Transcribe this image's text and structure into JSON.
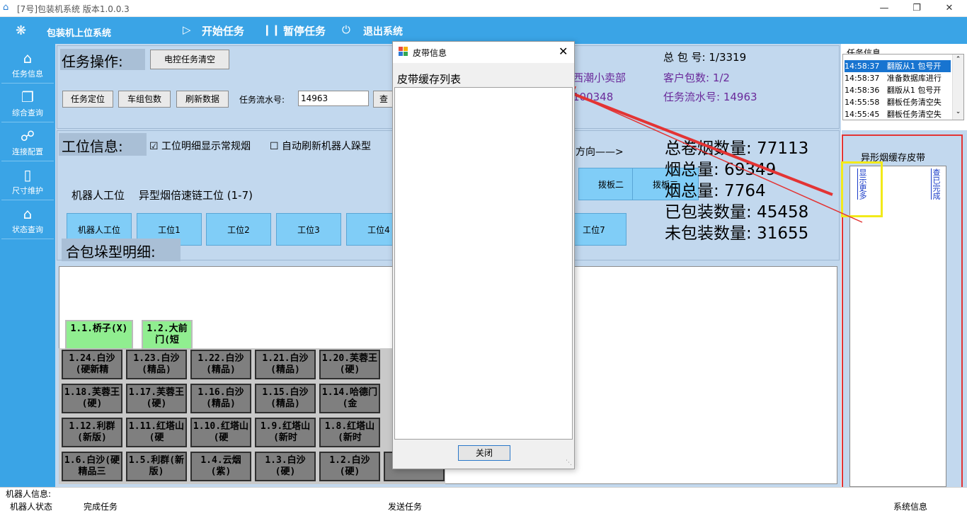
{
  "window": {
    "title": "[7号]包装机系统 版本1.0.0.3"
  },
  "topbar": {
    "system_name": "包装机上位系统",
    "start_task": "开始任务",
    "pause_task": "暂停任务",
    "exit_system": "退出系统"
  },
  "nav": [
    {
      "label": "任务信息",
      "icon": "home-icon"
    },
    {
      "label": "综合查询",
      "icon": "copy-icon"
    },
    {
      "label": "连接配置",
      "icon": "link-icon"
    },
    {
      "label": "尺寸维护",
      "icon": "document-icon"
    },
    {
      "label": "状态查询",
      "icon": "home-icon"
    }
  ],
  "task_ops": {
    "title": "任务操作:",
    "clear_btn": "电控任务清空",
    "locate_btn": "任务定位",
    "group_btn": "车组包数",
    "refresh_btn": "刷新数据",
    "serial_label": "任务流水号:",
    "serial_value": "14963",
    "query_btn_partial": "查"
  },
  "order_info": {
    "customer_partial": "西潮小卖部",
    "code_partial": "100348",
    "total_packages": "总 包 号: 1/3319",
    "customer_packages": "客户包数: 1/2",
    "serial_no": "任务流水号: 14963"
  },
  "station_info": {
    "title": "工位信息:",
    "chk_detail": "工位明细显示常规烟",
    "chk_refresh": "自动刷新机器人跺型",
    "direction_partial": "方向——>",
    "robot_station_label": "机器人工位",
    "special_station_label": "异型烟倍速链工位 (1-7)",
    "paddle2": "拨板二",
    "paddle3": "拨板三",
    "stations": [
      "机器人工位",
      "工位1",
      "工位2",
      "工位3",
      "工位4",
      "工位7"
    ]
  },
  "stats": {
    "total_rolls": "总卷烟数量: 77113",
    "row2_partial": "烟总量: 69349",
    "row3_partial": "烟总量: 7764",
    "packed": "已包装数量: 45458",
    "unpacked": "未包装数量: 31655"
  },
  "stack_detail": {
    "title": "合包垛型明细:",
    "green_tiles": [
      "1.1.桥子(X)",
      "1.2.大前门(短"
    ],
    "rows": [
      [
        "1.24.白沙(硬新精",
        "1.23.白沙(精品)",
        "1.22.白沙(精品)",
        "1.21.白沙(精品)",
        "1.20.芙蓉王(硬)"
      ],
      [
        "1.18.芙蓉王(硬)",
        "1.17.芙蓉王(硬)",
        "1.16.白沙(精品)",
        "1.15.白沙(精品)",
        "1.14.哈德门(金"
      ],
      [
        "1.12.利群(新版)",
        "1.11.红塔山(硬",
        "1.10.红塔山(硬",
        "1.9.红塔山(新时",
        "1.8.红塔山(新时"
      ],
      [
        "1.6.白沙(硬精品三",
        "1.5.利群(新版)",
        "1.4.云烟(紫)",
        "1.3.白沙(硬)",
        "1.2.白沙(硬)",
        "(硬)"
      ]
    ]
  },
  "modal": {
    "title": "皮带信息",
    "list_label": "皮带缓存列表",
    "close_btn": "关闭"
  },
  "task_log": {
    "title": "任务信息",
    "rows": [
      {
        "time": "14:58:37",
        "msg": "翻版从1 包号开"
      },
      {
        "time": "14:58:37",
        "msg": "准备数据库进行"
      },
      {
        "time": "14:58:36",
        "msg": "翻版从1 包号开"
      },
      {
        "time": "14:55:58",
        "msg": "翻板任务清空失"
      },
      {
        "time": "14:55:45",
        "msg": "翻板任务清空失"
      }
    ]
  },
  "belt_cache": {
    "title": "异形烟缓存皮带",
    "show_more": "显示更多",
    "query_done": "查已完成"
  },
  "statusbar": {
    "robot_info": "机器人信息:",
    "robot_state": "机器人状态",
    "done_task": "完成任务",
    "send_task": "发送任务",
    "sys_info": "系统信息"
  },
  "colors": {
    "accent": "#3aa4e6",
    "panel": "#c2d8ee",
    "tile_gray": "#7f7f7f",
    "tile_green": "#90ee90",
    "highlight_red": "#e33434",
    "highlight_yellow": "#f2ea1a"
  }
}
